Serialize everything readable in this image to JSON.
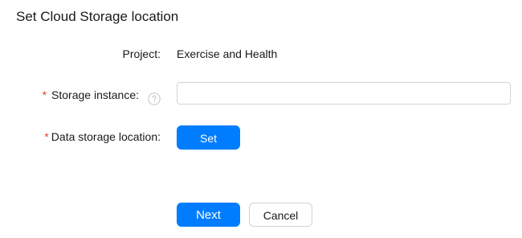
{
  "dialog": {
    "title": "Set Cloud Storage location"
  },
  "form": {
    "project": {
      "label": "Project:",
      "value": "Exercise and Health"
    },
    "storage_instance": {
      "required_mark": "*",
      "label": "Storage instance:",
      "value": "",
      "placeholder": "",
      "help_icon": "question-circle-icon"
    },
    "data_storage_location": {
      "required_mark": "*",
      "label": "Data storage location:",
      "button_label": "Set"
    }
  },
  "footer": {
    "next_label": "Next",
    "cancel_label": "Cancel"
  },
  "colors": {
    "primary": "#007dff",
    "required": "#e84026",
    "border": "#d3d3d3",
    "text": "#191919"
  }
}
